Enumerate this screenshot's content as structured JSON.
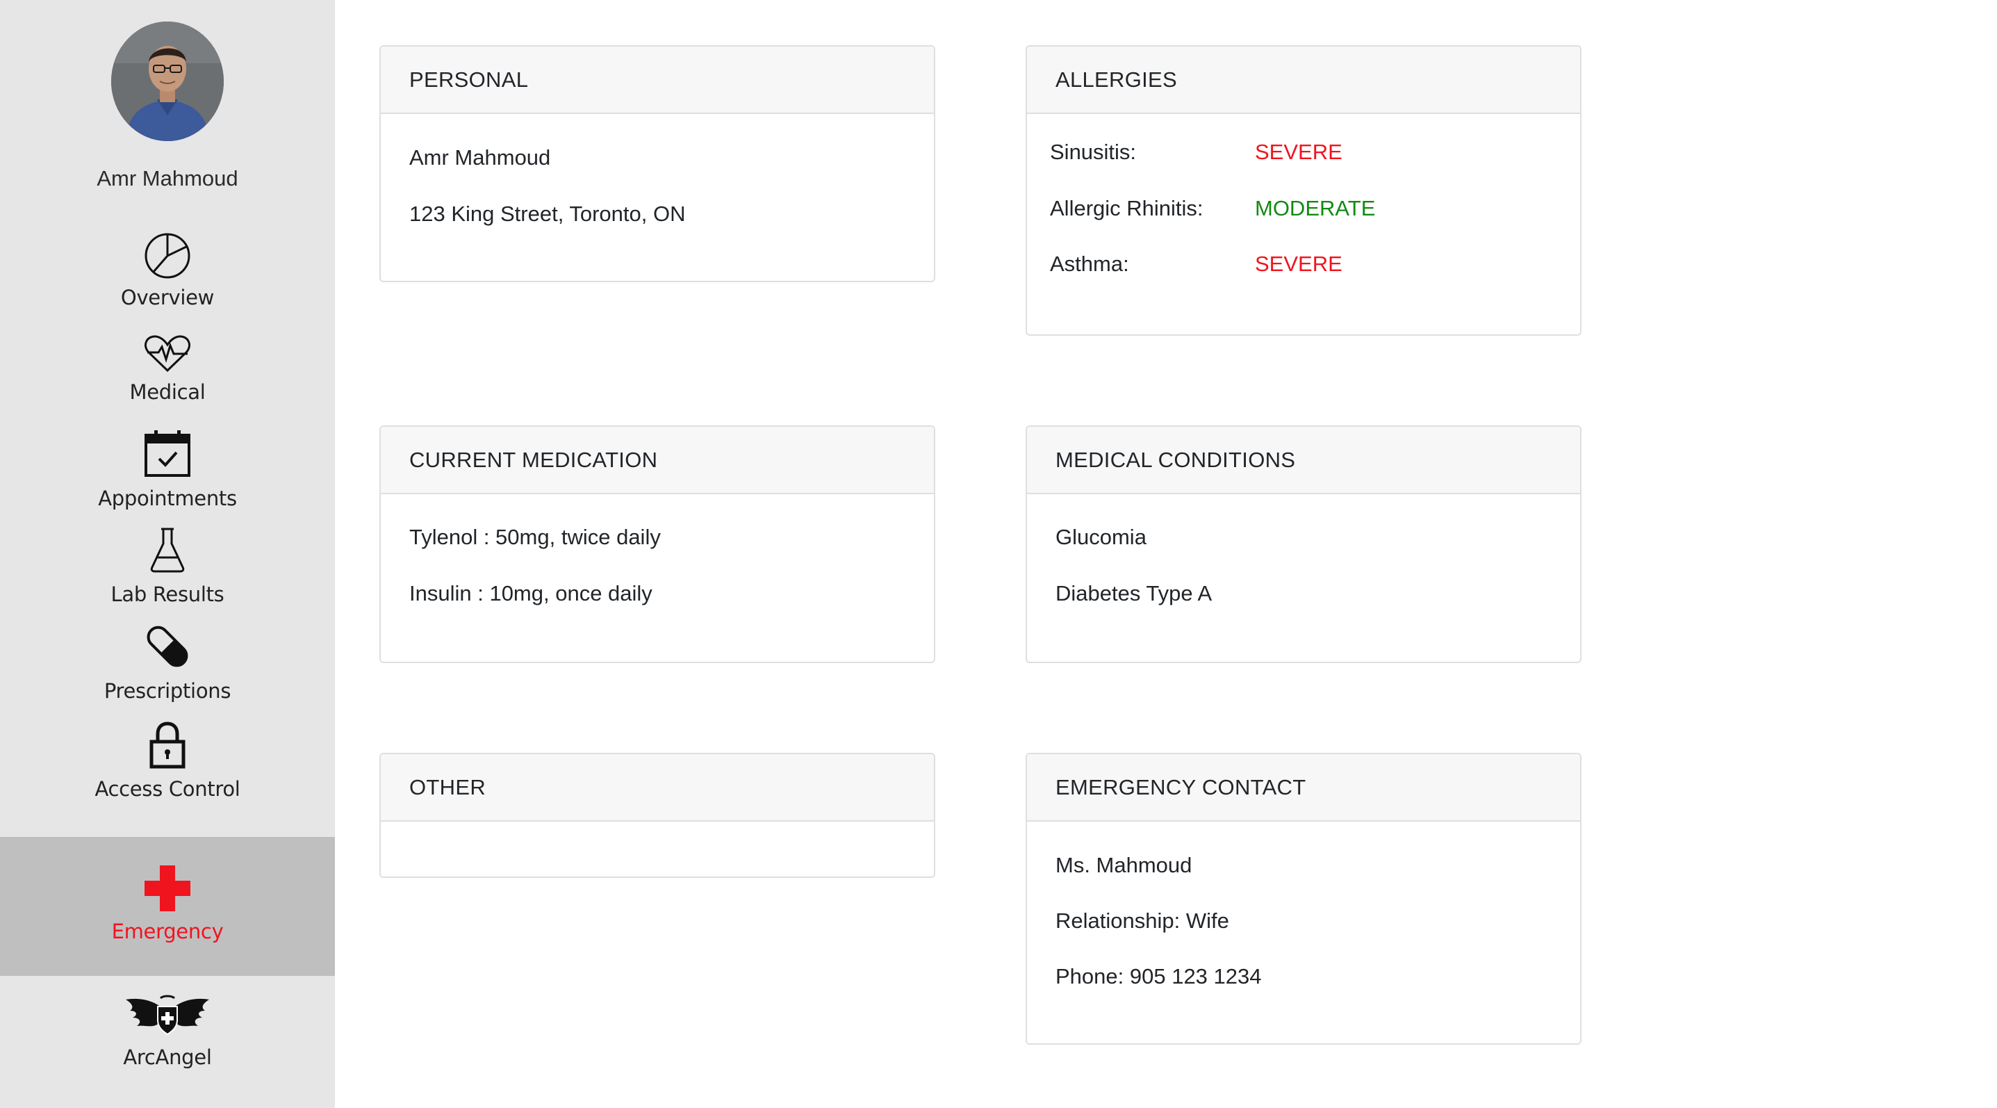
{
  "sidebar": {
    "user_name": "Amr Mahmoud",
    "items": [
      {
        "label": "Overview",
        "icon": "pie-chart-icon"
      },
      {
        "label": "Medical",
        "icon": "heart-pulse-icon"
      },
      {
        "label": "Appointments",
        "icon": "calendar-check-icon"
      },
      {
        "label": "Lab Results",
        "icon": "flask-icon"
      },
      {
        "label": "Prescriptions",
        "icon": "pill-icon"
      },
      {
        "label": "Access Control",
        "icon": "lock-icon"
      },
      {
        "label": "Emergency",
        "icon": "red-cross-icon",
        "active": true
      },
      {
        "label": "ArcAngel",
        "icon": "winged-shield-icon"
      }
    ]
  },
  "cards": {
    "personal": {
      "title": "PERSONAL",
      "lines": [
        "Amr Mahmoud",
        "123 King Street, Toronto, ON"
      ]
    },
    "allergies": {
      "title": "ALLERGIES",
      "items": [
        {
          "name": "Sinusitis:",
          "severity": "SEVERE"
        },
        {
          "name": "Allergic Rhinitis:",
          "severity": "MODERATE"
        },
        {
          "name": "Asthma:",
          "severity": "SEVERE"
        }
      ]
    },
    "medication": {
      "title": "CURRENT MEDICATION",
      "lines": [
        "Tylenol : 50mg, twice daily",
        "Insulin : 10mg, once daily"
      ]
    },
    "conditions": {
      "title": "MEDICAL CONDITIONS",
      "lines": [
        "Glucomia",
        "Diabetes Type A"
      ]
    },
    "other": {
      "title": "OTHER"
    },
    "emergency_contact": {
      "title": "EMERGENCY CONTACT",
      "lines": [
        "Ms. Mahmoud",
        "Relationship: Wife",
        "Phone: 905 123 1234"
      ]
    }
  },
  "colors": {
    "severe": "#f0141e",
    "moderate": "#138a13",
    "sidebar_bg": "#e6e6e7",
    "sidebar_active_bg": "#bfbfc0",
    "emergency": "#f0141e"
  }
}
